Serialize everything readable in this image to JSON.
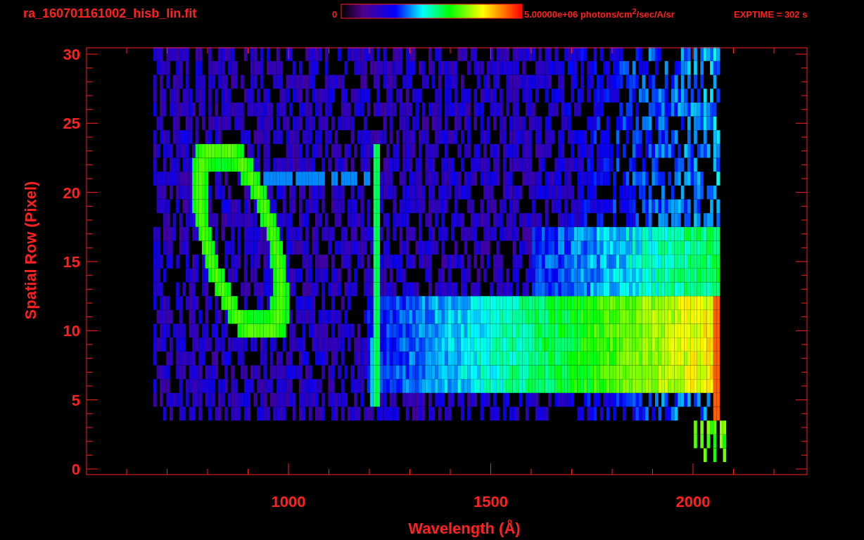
{
  "title": "ra_160701161002_hisb_lin.fit",
  "colorbar": {
    "min_label": "0",
    "max_label": "5.00000e+06 photons/cm$^{2}$/sec/A/sr"
  },
  "exposure": "EXPTIME = 302 s",
  "y_axis": {
    "label": "Spatial Row (Pixel)",
    "ticks": [
      "30",
      "25",
      "20",
      "15",
      "10",
      "5",
      "0"
    ]
  },
  "x_axis": {
    "label": "Wavelength (Å)",
    "ticks": [
      "1000",
      "1500",
      "2000"
    ]
  }
}
